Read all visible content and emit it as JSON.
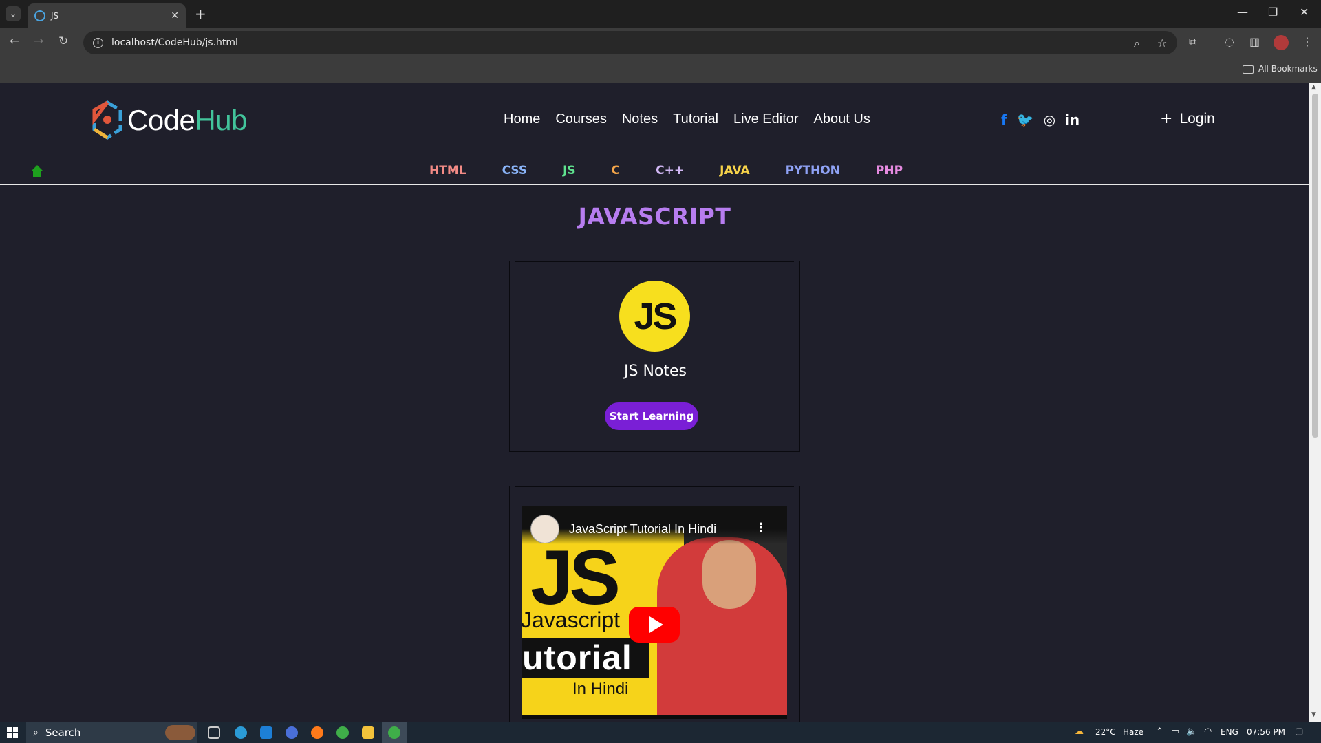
{
  "browser": {
    "tab_title": "JS",
    "tab_close": "✕",
    "new_tab": "+",
    "url": "localhost/CodeHub/js.html",
    "bookmarks_label": "All Bookmarks",
    "window_controls": [
      "—",
      "❐",
      "✕"
    ]
  },
  "site": {
    "logo_code": "Code",
    "logo_hub": "Hub",
    "nav": [
      "Home",
      "Courses",
      "Notes",
      "Tutorial",
      "Live Editor",
      "About Us"
    ],
    "social": [
      {
        "name": "facebook",
        "glyph": "f",
        "color": "#1877f2"
      },
      {
        "name": "twitter",
        "glyph": "🐦",
        "color": "#1da1f2"
      },
      {
        "name": "instagram",
        "glyph": "◎",
        "color": "#ffffff"
      },
      {
        "name": "linkedin",
        "glyph": "in",
        "color": "#ffffff"
      }
    ],
    "login_plus": "+",
    "login": "Login",
    "languages": [
      {
        "label": "HTML",
        "color": "#f38b86"
      },
      {
        "label": "CSS",
        "color": "#8ab4f8"
      },
      {
        "label": "JS",
        "color": "#5fe38f"
      },
      {
        "label": "C",
        "color": "#f5a64a"
      },
      {
        "label": "C++",
        "color": "#d2b8f5"
      },
      {
        "label": "JAVA",
        "color": "#f7d34a"
      },
      {
        "label": "PYTHON",
        "color": "#8fa2f5"
      },
      {
        "label": "PHP",
        "color": "#e58ae0"
      }
    ],
    "page_title": "JAVASCRIPT",
    "card": {
      "badge": "JS",
      "title": "JS Notes",
      "button": "Start Learning"
    },
    "video": {
      "title": "JavaScript Tutorial In Hindi",
      "menu": "⋮",
      "thumb_js": "JS",
      "thumb_javascript": "Javascript",
      "thumb_tutorial": "utorial",
      "thumb_inhindi": "In Hindi"
    }
  },
  "taskbar": {
    "search_placeholder": "Search",
    "temperature": "22°C",
    "weather": "Haze",
    "language": "ENG",
    "time": "07:56 PM"
  }
}
